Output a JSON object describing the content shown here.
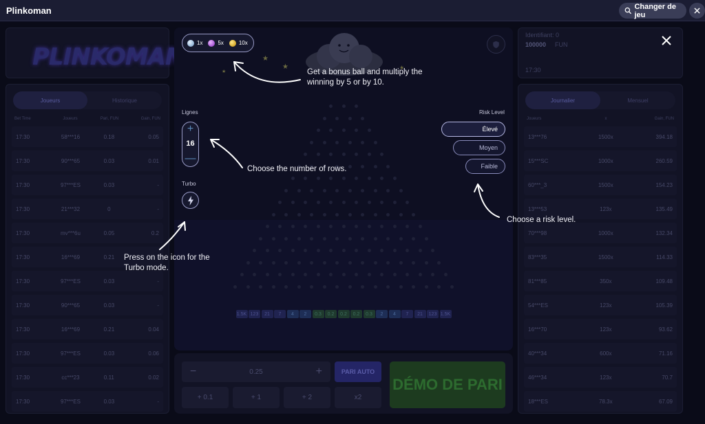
{
  "header": {
    "title": "Plinkoman",
    "change_game_label": "Changer de jeu"
  },
  "logo": {
    "text": "PLINKOMAN"
  },
  "left_panel": {
    "tabs": [
      {
        "label": "Joueurs",
        "active": true
      },
      {
        "label": "Historique",
        "active": false
      }
    ],
    "columns": [
      "Bet Time",
      "Joueurs",
      "Pari, FUN",
      "Gain, FUN"
    ],
    "rows": [
      [
        "17:30",
        "58***16",
        "0.18",
        "0.05"
      ],
      [
        "17:30",
        "90***65",
        "0.03",
        "0.01"
      ],
      [
        "17:30",
        "97***ES",
        "0.03",
        "-"
      ],
      [
        "17:30",
        "21***32",
        "0",
        "-"
      ],
      [
        "17:30",
        "mv***6u",
        "0.05",
        "0.2"
      ],
      [
        "17:30",
        "16***69",
        "0.21",
        "-"
      ],
      [
        "17:30",
        "97***ES",
        "0.03",
        "-"
      ],
      [
        "17:30",
        "90***65",
        "0.03",
        "-"
      ],
      [
        "17:30",
        "16***69",
        "0.21",
        "0.04"
      ],
      [
        "17:30",
        "97***ES",
        "0.03",
        "0.06"
      ],
      [
        "17:30",
        "cc***23",
        "0.11",
        "0.02"
      ],
      [
        "17:30",
        "97***ES",
        "0.03",
        "-"
      ]
    ]
  },
  "right_panel": {
    "identifier": "Identifiant: 0",
    "balance": "100000",
    "currency": "FUN",
    "time": "17:30",
    "tabs": [
      {
        "label": "Journalier",
        "active": true
      },
      {
        "label": "Mensuel",
        "active": false
      }
    ],
    "columns": [
      "Joueurs",
      "x",
      "Gain, FUN"
    ],
    "rows": [
      [
        "13***76",
        "1500x",
        "394.18"
      ],
      [
        "15***SC",
        "1000x",
        "260.59"
      ],
      [
        "60***_3",
        "1500x",
        "154.23"
      ],
      [
        "13***53",
        "123x",
        "135.49"
      ],
      [
        "70***98",
        "1000x",
        "132.34"
      ],
      [
        "83***35",
        "1500x",
        "114.33"
      ],
      [
        "81***85",
        "350x",
        "109.48"
      ],
      [
        "54***ES",
        "123x",
        "105.39"
      ],
      [
        "16***70",
        "123x",
        "93.62"
      ],
      [
        "40***34",
        "600x",
        "71.16"
      ],
      [
        "46***34",
        "123x",
        "70.7"
      ],
      [
        "18***ES",
        "78.3x",
        "67.09"
      ]
    ]
  },
  "bonus": {
    "items": [
      {
        "label": "1x",
        "color": "#9fc3e6"
      },
      {
        "label": "5x",
        "color": "#b04ee0"
      },
      {
        "label": "10x",
        "color": "#e8b820"
      }
    ]
  },
  "controls": {
    "rows_label": "Lignes",
    "rows_value": "16",
    "turbo_label": "Turbo",
    "risk_label": "Risk Level",
    "risk_options": [
      {
        "label": "Élevé",
        "active": true
      },
      {
        "label": "Moyen",
        "active": false
      },
      {
        "label": "Faible",
        "active": false
      }
    ]
  },
  "board": {
    "multipliers": [
      "1.5K",
      "123",
      "21",
      "7",
      "4",
      "2",
      "0.3",
      "0.2",
      "0.2",
      "0.2",
      "0.3",
      "2",
      "4",
      "7",
      "21",
      "123",
      "1.5K"
    ]
  },
  "bet": {
    "amount": "0.25",
    "auto_label": "PARI AUTO",
    "quick": [
      "+ 0.1",
      "+ 1",
      "+ 2",
      "x2"
    ],
    "demo_label": "DÉMO DE PARI"
  },
  "tips": {
    "bonus": "Get a bonus ball and multiply the winning by 5 or by 10.",
    "rows": "Choose the number of rows.",
    "turbo": "Press on the icon for the Turbo mode.",
    "risk": "Choose a risk level."
  },
  "colors": {
    "accent": "#9a9cc8",
    "demo_green": "#1d3b1f",
    "background": "#0a0b18"
  }
}
